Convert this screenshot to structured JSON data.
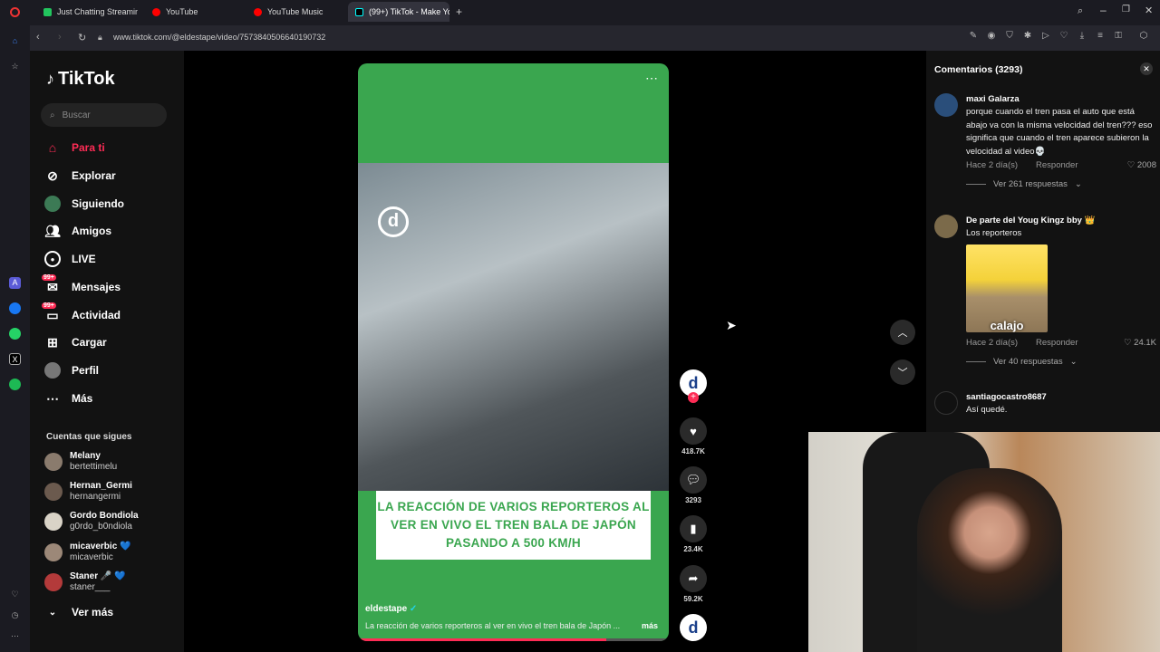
{
  "browser": {
    "tabs": [
      {
        "label": "Just Chatting Streaming -",
        "color": "#22c55e"
      },
      {
        "label": "YouTube",
        "color": "#ff0000"
      },
      {
        "label": "YouTube Music",
        "color": "#ff0000"
      },
      {
        "label": "(99+) TikTok - Make Yo",
        "color": "#000000"
      }
    ],
    "url": "www.tiktok.com/@eldestape/video/7573840506640190732"
  },
  "sidebar": {
    "logo": "TikTok",
    "search_placeholder": "Buscar",
    "nav": [
      {
        "label": "Para ti",
        "icon": "home-icon",
        "active": true
      },
      {
        "label": "Explorar",
        "icon": "compass-icon"
      },
      {
        "label": "Siguiendo",
        "icon": "following-icon"
      },
      {
        "label": "Amigos",
        "icon": "friends-icon"
      },
      {
        "label": "LIVE",
        "icon": "live-icon"
      },
      {
        "label": "Mensajes",
        "icon": "messages-icon",
        "badge": "99+"
      },
      {
        "label": "Actividad",
        "icon": "activity-icon",
        "badge": "99+"
      },
      {
        "label": "Cargar",
        "icon": "upload-icon"
      },
      {
        "label": "Perfil",
        "icon": "profile-icon"
      },
      {
        "label": "Más",
        "icon": "more-icon"
      }
    ],
    "following_label": "Cuentas que sigues",
    "following": [
      {
        "name": "Melany",
        "user": "bertettimelu"
      },
      {
        "name": "Hernan_Germi",
        "user": "hernangermi"
      },
      {
        "name": "Gordo Bondiola",
        "user": "g0rdo_b0ndiola"
      },
      {
        "name": "micaverbic 💙",
        "user": "micaverbic"
      },
      {
        "name": "Staner 🎤 💙",
        "user": "staner___"
      }
    ],
    "see_more": "Ver más"
  },
  "video": {
    "overlay_caption": "LA REACCIÓN DE VARIOS REPORTEROS AL VER EN VIVO EL TREN BALA DE JAPÓN PASANDO A 500 KM/H",
    "username": "eldestape",
    "description": "La reacción de varios reporteros al ver en vivo el tren bala de Japón ...",
    "more": "más",
    "progress": 0.8
  },
  "actions": {
    "likes": "418.7K",
    "comments": "3293",
    "saves": "23.4K",
    "shares": "59.2K"
  },
  "comments": {
    "header": "Comentarios (3293)",
    "items": [
      {
        "user": "maxi Galarza",
        "text": "porque cuando el tren pasa el auto que está abajo va con la misma velocidad del tren??? eso significa que cuando el tren aparece subieron la velocidad al video💀",
        "time": "Hace 2 día(s)",
        "reply": "Responder",
        "likes": "2008",
        "replies": "Ver 261 respuestas"
      },
      {
        "user": "De parte del Youg Kingz bby 👑",
        "text": "Los reporteros",
        "sticker": "calajo",
        "time": "Hace 2 día(s)",
        "reply": "Responder",
        "likes": "24.1K",
        "replies": "Ver 40 respuestas"
      },
      {
        "user": "santiagocastro8687",
        "text": "Así quedé."
      }
    ]
  }
}
